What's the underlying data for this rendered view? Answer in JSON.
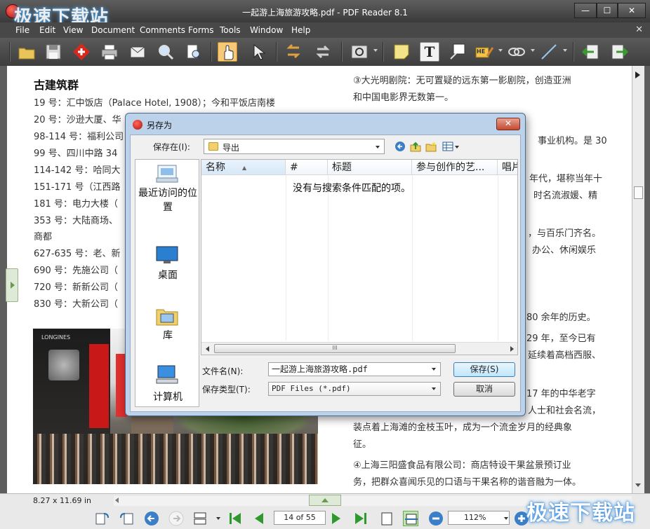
{
  "window": {
    "title": "一起游上海旅游攻略.pdf - PDF Reader 8.1",
    "watermark": "极速下载站",
    "min_label": "—",
    "max_label": "☐",
    "close_label": "✕"
  },
  "menu": {
    "items": [
      "File",
      "Edit",
      "View",
      "Document",
      "Comments",
      "Forms",
      "Tools",
      "Window",
      "Help"
    ],
    "close": "✕"
  },
  "toolbar": {
    "icons": [
      "open-icon",
      "save-icon",
      "foxit-icon",
      "print-icon",
      "email-icon",
      "search-icon",
      "find-icon",
      "hand-icon",
      "select-icon",
      "back-icon",
      "forward-icon",
      "settings-icon",
      "note-icon",
      "typewriter-icon",
      "callout-icon",
      "highlight-icon",
      "link-icon",
      "line-icon",
      "import-icon",
      "export-icon"
    ],
    "typewriter_glyph": "T",
    "highlight_glyph": "HE"
  },
  "document": {
    "heading": "古建筑群",
    "left_lines": [
      "19 号：汇中饭店（Palace Hotel, 1908）；今和平饭店南楼",
      "20 号：沙逊大厦、华",
      "98-114 号：福利公司",
      "99 号、四川中路 34",
      "114-142 号：哈同大",
      "151-171 号（江西路",
      "181 号：电力大楼（",
      "353  号：大陆商场、",
      "商都",
      "627-635 号：老、新",
      "690 号：先施公司（",
      "720 号：新新公司（",
      "830 号：大新公司（"
    ],
    "right_lines": [
      "③大光明剧院：无可置疑的远东第一影剧院，创造亚洲",
      "和中国电影界无数第一。",
      "事业机构。是  30",
      "年代，堪称当年十",
      "时名流淑媛、精",
      "，与百乐门齐名。",
      "办公、休闲娱乐",
      "80 余年的历史。",
      "29  年，至今已有",
      "延续着高档西服、",
      "17  年的中华老字",
      "人士和社会名流，",
      "装点着上海滩的金枝玉叶，成为一个流金岁月的经典象",
      "征。",
      "④上海三阳盛食品有限公司：商店特设干果盆景预订业",
      "务，把群众喜闻乐见的口语与干果名称的谐音融为一体。"
    ],
    "photo_caption": "LONGINES"
  },
  "statusbar": {
    "page_size": "8.27 x 11.69 in",
    "page_indicator": "14 of 55",
    "zoom": "112%",
    "watermark": "极速下载站"
  },
  "dialog": {
    "title": "另存为",
    "close_label": "✕",
    "save_in_label": "保存在(I):",
    "save_in_value": "导出",
    "places": [
      "最近访问的位置",
      "桌面",
      "库",
      "计算机"
    ],
    "columns": [
      "名称",
      "#",
      "标题",
      "参与创作的艺...",
      "唱片"
    ],
    "empty_message": "没有与搜索条件匹配的项。",
    "filename_label": "文件名(N):",
    "filename_value": "一起游上海旅游攻略.pdf",
    "filetype_label": "保存类型(T):",
    "filetype_value": "PDF Files (*.pdf)",
    "save_button": "保存(S)",
    "cancel_button": "取消",
    "scroll_grip": "III"
  }
}
